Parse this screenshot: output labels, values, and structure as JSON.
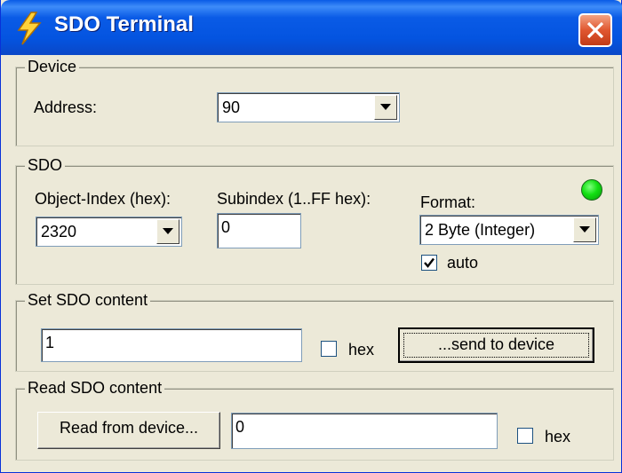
{
  "window": {
    "title": "SDO Terminal"
  },
  "device": {
    "group_label": "Device",
    "address_label": "Address:",
    "address_value": "90"
  },
  "sdo": {
    "group_label": "SDO",
    "object_index_label": "Object-Index (hex):",
    "object_index_value": "2320",
    "subindex_label": "Subindex (1..FF hex):",
    "subindex_value": "0",
    "format_label": "Format:",
    "format_value": "2 Byte (Integer)",
    "auto_label": "auto",
    "auto_checked": true,
    "status_color": "#12e012"
  },
  "set_content": {
    "group_label": "Set SDO content",
    "value": "1",
    "hex_label": "hex",
    "hex_checked": false,
    "send_button": "...send to device"
  },
  "read_content": {
    "group_label": "Read SDO content",
    "read_button": "Read from device...",
    "value": "0",
    "hex_label": "hex",
    "hex_checked": false
  },
  "icons": {
    "app": "lightning-icon",
    "close": "close-icon",
    "dropdown": "chevron-down-icon",
    "check": "check-icon"
  }
}
